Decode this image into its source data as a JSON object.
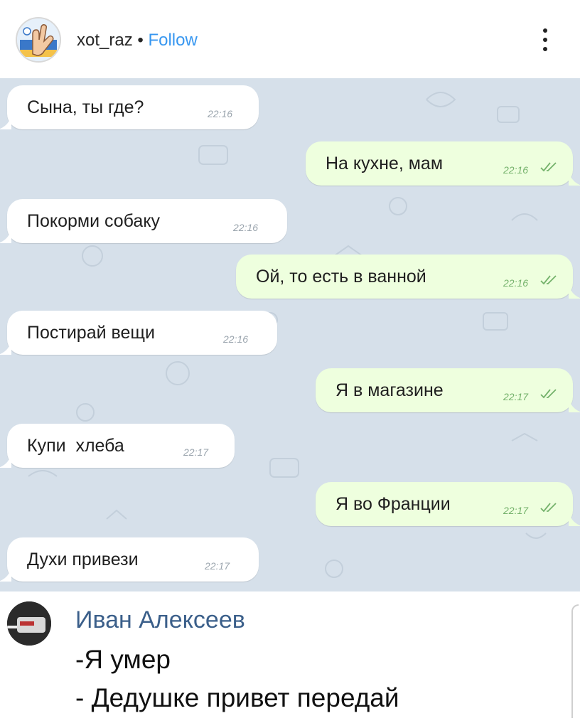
{
  "header": {
    "username": "xot_raz",
    "separator": " • ",
    "follow_label": "Follow",
    "more_icon": "more-vertical-icon"
  },
  "chat": {
    "messages": [
      {
        "side": "in",
        "text": "Сына, ты где?",
        "time": "22:16"
      },
      {
        "side": "out",
        "text": "На кухне, мам",
        "time": "22:16"
      },
      {
        "side": "in",
        "text": "Покорми собаку",
        "time": "22:16"
      },
      {
        "side": "out",
        "text": "Ой, то есть в ванной",
        "time": "22:16"
      },
      {
        "side": "in",
        "text": "Постирай вещи",
        "time": "22:16"
      },
      {
        "side": "out",
        "text": "Я в магазине",
        "time": "22:17"
      },
      {
        "side": "in",
        "text": "Купи  хлеба",
        "time": "22:17"
      },
      {
        "side": "out",
        "text": "Я во Франции",
        "time": "22:17"
      },
      {
        "side": "in",
        "text": "Духи привези",
        "time": "22:17"
      }
    ],
    "colors": {
      "background": "#d6e0ea",
      "incoming_bubble": "#ffffff",
      "outgoing_bubble": "#eeffde",
      "read_tick": "#74b26b"
    }
  },
  "comment": {
    "author": "Иван Алексеев",
    "line1": "-Я умер",
    "line2": "- Дедушке привет передай",
    "name_color": "#3b5f8a"
  }
}
